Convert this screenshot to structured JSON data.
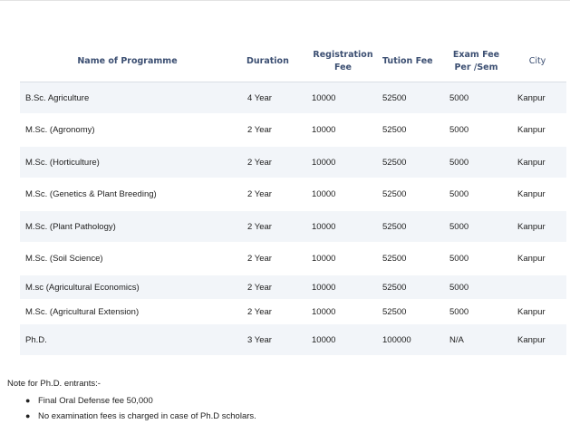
{
  "table": {
    "headers": {
      "name": "Name of Programme",
      "duration": "Duration",
      "registration_line1": "Registration",
      "registration_line2": "Fee",
      "tution": "Tution Fee",
      "exam_line1": "Exam Fee",
      "exam_line2": "Per /Sem",
      "city": "City"
    },
    "rows": [
      {
        "name": "B.Sc. Agriculture",
        "duration": "4 Year",
        "registration": "10000",
        "tution": "52500",
        "exam": "5000",
        "city": "Kanpur"
      },
      {
        "name": "M.Sc. (Agronomy)",
        "duration": "2 Year",
        "registration": "10000",
        "tution": "52500",
        "exam": "5000",
        "city": "Kanpur"
      },
      {
        "name": "M.Sc. (Horticulture)",
        "duration": "2 Year",
        "registration": "10000",
        "tution": "52500",
        "exam": "5000",
        "city": "Kanpur"
      },
      {
        "name": "M.Sc. (Genetics & Plant Breeding)",
        "duration": "2 Year",
        "registration": "10000",
        "tution": "52500",
        "exam": "5000",
        "city": "Kanpur"
      },
      {
        "name": "M.Sc. (Plant Pathology)",
        "duration": "2 Year",
        "registration": "10000",
        "tution": "52500",
        "exam": "5000",
        "city": "Kanpur"
      },
      {
        "name": "M.Sc. (Soil Science)",
        "duration": "2 Year",
        "registration": "10000",
        "tution": "52500",
        "exam": "5000",
        "city": "Kanpur"
      },
      {
        "name": "M.sc (Agricultural Economics)",
        "duration": "2 Year",
        "registration": "10000",
        "tution": "52500",
        "exam": "5000",
        "city": ""
      },
      {
        "name": "M.Sc. (Agricultural Extension)",
        "duration": "2 Year",
        "registration": "10000",
        "tution": "52500",
        "exam": "5000",
        "city": "Kanpur"
      },
      {
        "name": "Ph.D.",
        "duration": "3 Year",
        "registration": "10000",
        "tution": "100000",
        "exam": "N/A",
        "city": "Kanpur"
      }
    ]
  },
  "note": {
    "title": "Note for Ph.D. entrants:-",
    "items": [
      "Final Oral Defense fee 50,000",
      "No examination fees is charged in case of Ph.D scholars."
    ]
  }
}
